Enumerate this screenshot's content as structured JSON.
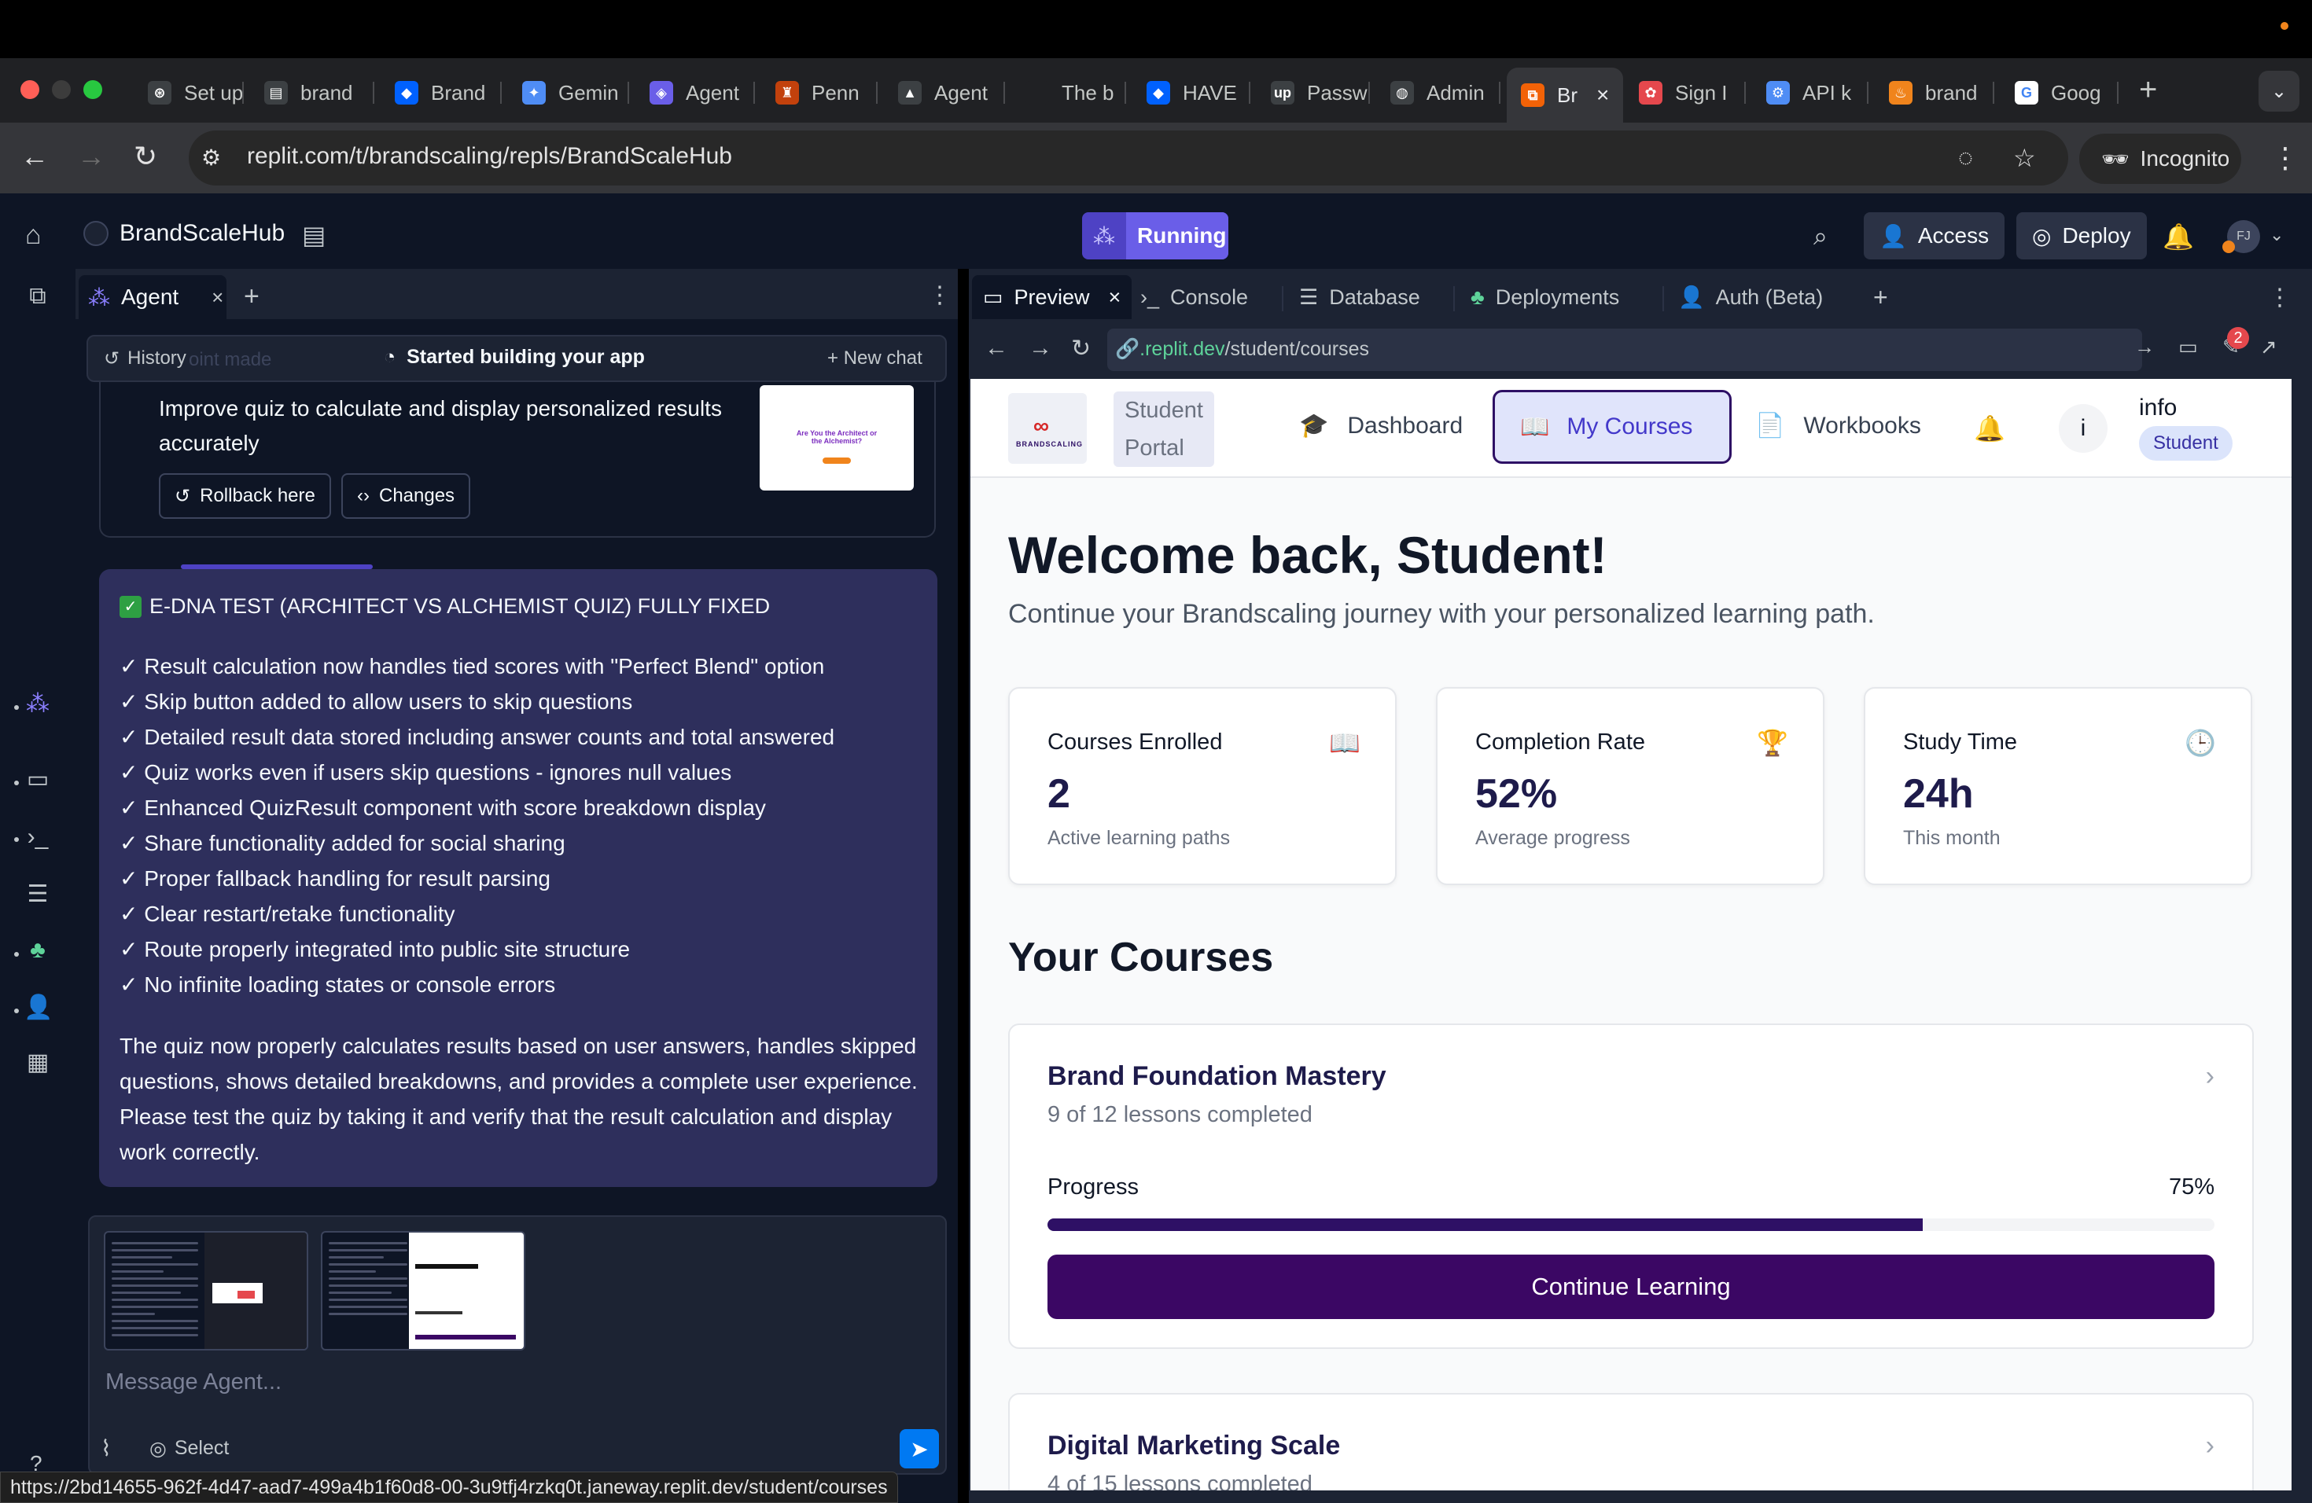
{
  "browser": {
    "tabs": [
      {
        "label": "Set up",
        "favicon": "openai-icon",
        "color": "#3c4043"
      },
      {
        "label": "brand",
        "favicon": "doc-icon",
        "color": "#3c4043"
      },
      {
        "label": "Brand",
        "favicon": "dropbox-icon",
        "color": "#0061fe"
      },
      {
        "label": "Gemin",
        "favicon": "gemini-icon",
        "color": "#4f8df5"
      },
      {
        "label": "Agent",
        "favicon": "agent-icon",
        "color": "#6a5ee8"
      },
      {
        "label": "Penn",
        "favicon": "penn-icon",
        "color": "#c2410c"
      },
      {
        "label": "Agent",
        "favicon": "triangle-icon",
        "color": "#3c4043"
      },
      {
        "label": "The b",
        "favicon": "blank-icon",
        "color": "#202124"
      },
      {
        "label": "HAVE",
        "favicon": "dropbox-icon",
        "color": "#0061fe"
      },
      {
        "label": "Passw",
        "favicon": "upwork-icon",
        "color": "#3c4043"
      },
      {
        "label": "Admin",
        "favicon": "globe-icon",
        "color": "#3c4043"
      },
      {
        "label": "Br",
        "favicon": "replit-icon",
        "color": "#f26207"
      },
      {
        "label": "Sign I",
        "favicon": "sign-icon",
        "color": "#e5484d"
      },
      {
        "label": "API k",
        "favicon": "api-icon",
        "color": "#4f8df5"
      },
      {
        "label": "brand",
        "favicon": "fire-icon",
        "color": "#f0841c"
      },
      {
        "label": "Goog",
        "favicon": "google-icon",
        "color": "#ffffff"
      }
    ],
    "url": "replit.com/t/brandscaling/repls/BrandScaleHub",
    "incognito_label": "Incognito",
    "status_url": "https://2bd14655-962f-4d47-aad7-499a4b1f60d8-00-3u9tfj4rzkq0t.janeway.replit.dev/student/courses"
  },
  "replit": {
    "project_name": "BrandScaleHub",
    "run_status": "Running",
    "access_label": "Access",
    "deploy_label": "Deploy",
    "avatar_initials": "FJ"
  },
  "agent": {
    "tab_label": "Agent",
    "history_label": "History",
    "history_ghost": "oint made",
    "started_label": "Started building your app",
    "new_chat_label": "New chat",
    "checkpoint_text": "Improve quiz to calculate and display personalized results accurately",
    "rollback_label": "Rollback here",
    "changes_label": "Changes",
    "thumb_title": "Are You the Architect or the Alchemist?",
    "message_title": "E-DNA TEST (ARCHITECT VS ALCHEMIST QUIZ) FULLY FIXED",
    "message_items": [
      "✓ Result calculation now handles tied scores with \"Perfect Blend\" option",
      "✓ Skip button added to allow users to skip questions",
      "✓ Detailed result data stored including answer counts and total answered",
      "✓ Quiz works even if users skip questions - ignores null values",
      "✓ Enhanced QuizResult component with score breakdown display",
      "✓ Share functionality added for social sharing",
      "✓ Proper fallback handling for result parsing",
      "✓ Clear restart/retake functionality",
      "✓ Route properly integrated into public site structure",
      "✓ No infinite loading states or console errors"
    ],
    "message_paragraph": "The quiz now properly calculates results based on user answers, handles skipped questions, shows detailed breakdowns, and provides a complete user experience. Please test the quiz by taking it and verify that the result calculation and display work correctly.",
    "input_placeholder": "Message Agent...",
    "select_label": "Select"
  },
  "preview": {
    "tabs": [
      "Preview",
      "Console",
      "Database",
      "Deployments",
      "Auth (Beta)"
    ],
    "url_host": ".replit.dev",
    "url_path": "/student/courses",
    "notification_count": "2"
  },
  "site": {
    "portal_label": "Student Portal",
    "nav": {
      "dashboard": "Dashboard",
      "my_courses": "My Courses",
      "workbooks": "Workbooks"
    },
    "user": {
      "initial": "i",
      "name": "info",
      "role": "Student"
    },
    "welcome": "Welcome back, Student!",
    "subtitle": "Continue your Brandscaling journey with your personalized learning path.",
    "stats": [
      {
        "title": "Courses Enrolled",
        "value": "2",
        "sub": "Active learning paths",
        "icon": "book-icon"
      },
      {
        "title": "Completion Rate",
        "value": "52%",
        "sub": "Average progress",
        "icon": "trophy-icon"
      },
      {
        "title": "Study Time",
        "value": "24h",
        "sub": "This month",
        "icon": "clock-icon"
      }
    ],
    "section_title": "Your Courses",
    "courses": [
      {
        "title": "Brand Foundation Mastery",
        "sub": "9 of 12 lessons completed",
        "progress_label": "Progress",
        "progress_text": "75%",
        "progress": 0.75,
        "button": "Continue Learning"
      },
      {
        "title": "Digital Marketing Scale",
        "sub": "4 of 15 lessons completed"
      }
    ],
    "logo_text": "BRANDSCALING"
  },
  "colors": {
    "accent": "#2e1065",
    "running": "#6a5ee8",
    "agent_message_bg": "#2e2f5c"
  }
}
